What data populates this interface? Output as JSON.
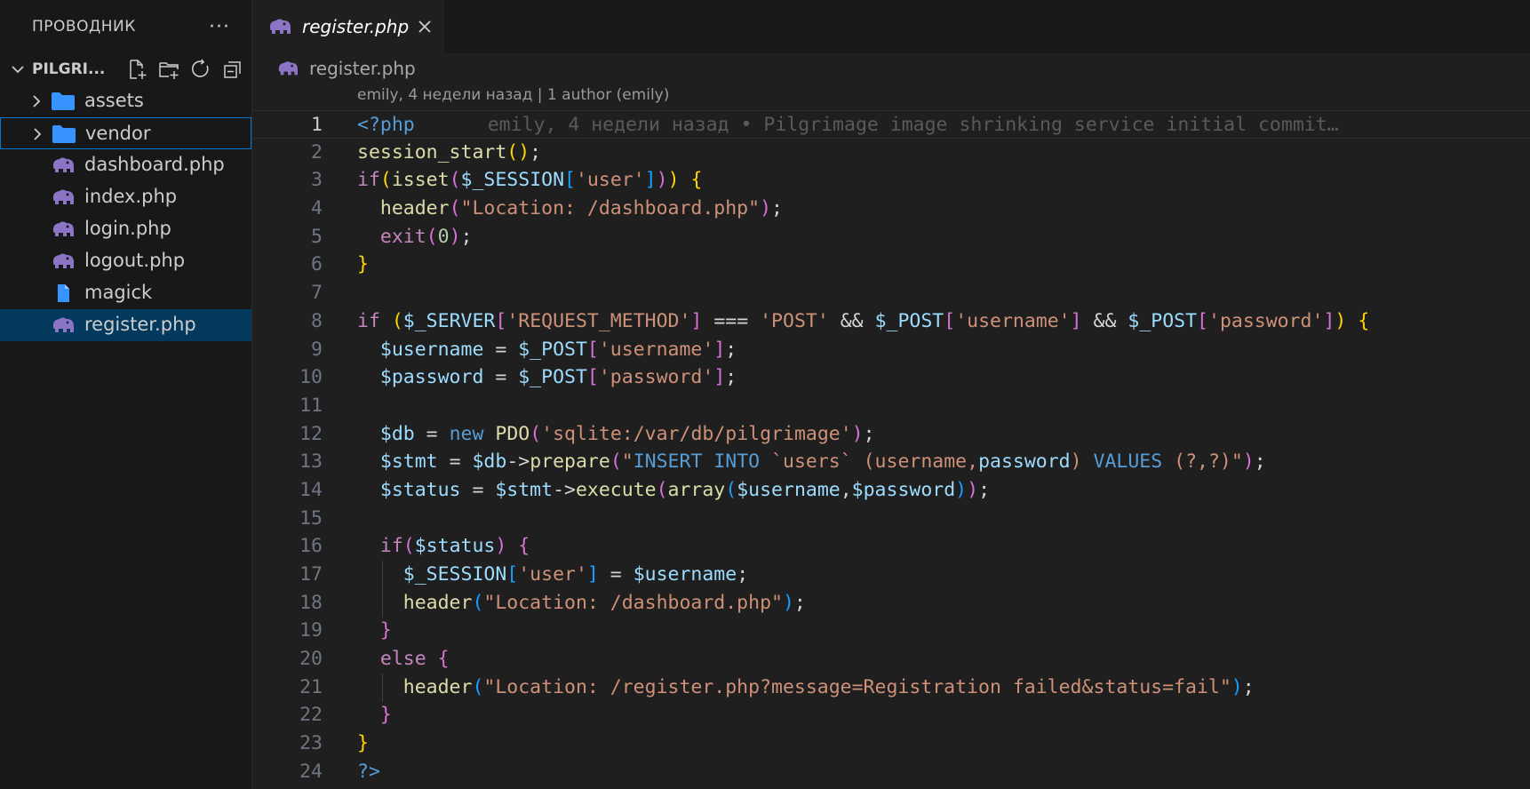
{
  "explorer": {
    "title": "ПРОВОДНИК",
    "more": "···",
    "folder": "PILGRI...",
    "items": [
      {
        "label": "assets",
        "type": "folder"
      },
      {
        "label": "vendor",
        "type": "folder"
      },
      {
        "label": "dashboard.php",
        "type": "php"
      },
      {
        "label": "index.php",
        "type": "php"
      },
      {
        "label": "login.php",
        "type": "php"
      },
      {
        "label": "logout.php",
        "type": "php"
      },
      {
        "label": "magick",
        "type": "file"
      },
      {
        "label": "register.php",
        "type": "php"
      }
    ]
  },
  "tab": {
    "label": "register.php",
    "close": "close-icon"
  },
  "breadcrumb": {
    "label": "register.php"
  },
  "codelens": "emily, 4 недели назад | 1 author (emily)",
  "blame": "emily, 4 недели назад • Pilgrimage image shrinking service initial commit…",
  "colors": {
    "accent": "#0078d4",
    "selected": "#04395e",
    "php_icon": "#8c75c4",
    "folder": "#3794ff"
  },
  "code": {
    "lines": [
      [
        [
          "tag",
          "<?php"
        ]
      ],
      [
        [
          "fn",
          "session_start"
        ],
        [
          "b1",
          "()"
        ],
        [
          "txt",
          ";"
        ]
      ],
      [
        [
          "ctl",
          "if"
        ],
        [
          "b1",
          "("
        ],
        [
          "fn",
          "isset"
        ],
        [
          "b2",
          "("
        ],
        [
          "var",
          "$_SESSION"
        ],
        [
          "b3",
          "["
        ],
        [
          "str",
          "'user'"
        ],
        [
          "b3",
          "]"
        ],
        [
          "b2",
          ")"
        ],
        [
          "b1",
          ")"
        ],
        [
          "txt",
          " "
        ],
        [
          "b1",
          "{"
        ]
      ],
      [
        [
          "txt",
          "  "
        ],
        [
          "fn",
          "header"
        ],
        [
          "b2",
          "("
        ],
        [
          "str",
          "\"Location: /dashboard.php\""
        ],
        [
          "b2",
          ")"
        ],
        [
          "txt",
          ";"
        ]
      ],
      [
        [
          "txt",
          "  "
        ],
        [
          "ctl",
          "exit"
        ],
        [
          "b2",
          "("
        ],
        [
          "num",
          "0"
        ],
        [
          "b2",
          ")"
        ],
        [
          "txt",
          ";"
        ]
      ],
      [
        [
          "b1",
          "}"
        ]
      ],
      [],
      [
        [
          "ctl",
          "if"
        ],
        [
          "txt",
          " "
        ],
        [
          "b1",
          "("
        ],
        [
          "var",
          "$_SERVER"
        ],
        [
          "b2",
          "["
        ],
        [
          "str",
          "'REQUEST_METHOD'"
        ],
        [
          "b2",
          "]"
        ],
        [
          "txt",
          " === "
        ],
        [
          "str",
          "'POST'"
        ],
        [
          "txt",
          " && "
        ],
        [
          "var",
          "$_POST"
        ],
        [
          "b2",
          "["
        ],
        [
          "str",
          "'username'"
        ],
        [
          "b2",
          "]"
        ],
        [
          "txt",
          " && "
        ],
        [
          "var",
          "$_POST"
        ],
        [
          "b2",
          "["
        ],
        [
          "str",
          "'password'"
        ],
        [
          "b2",
          "]"
        ],
        [
          "b1",
          ")"
        ],
        [
          "txt",
          " "
        ],
        [
          "b1",
          "{"
        ]
      ],
      [
        [
          "txt",
          "  "
        ],
        [
          "var",
          "$username"
        ],
        [
          "txt",
          " = "
        ],
        [
          "var",
          "$_POST"
        ],
        [
          "b2",
          "["
        ],
        [
          "str",
          "'username'"
        ],
        [
          "b2",
          "]"
        ],
        [
          "txt",
          ";"
        ]
      ],
      [
        [
          "txt",
          "  "
        ],
        [
          "var",
          "$password"
        ],
        [
          "txt",
          " = "
        ],
        [
          "var",
          "$_POST"
        ],
        [
          "b2",
          "["
        ],
        [
          "str",
          "'password'"
        ],
        [
          "b2",
          "]"
        ],
        [
          "txt",
          ";"
        ]
      ],
      [],
      [
        [
          "txt",
          "  "
        ],
        [
          "var",
          "$db"
        ],
        [
          "txt",
          " = "
        ],
        [
          "kw",
          "new"
        ],
        [
          "txt",
          " "
        ],
        [
          "fn",
          "PDO"
        ],
        [
          "b2",
          "("
        ],
        [
          "str",
          "'sqlite:/var/db/pilgrimage'"
        ],
        [
          "b2",
          ")"
        ],
        [
          "txt",
          ";"
        ]
      ],
      [
        [
          "txt",
          "  "
        ],
        [
          "var",
          "$stmt"
        ],
        [
          "txt",
          " = "
        ],
        [
          "var",
          "$db"
        ],
        [
          "txt",
          "->"
        ],
        [
          "fn",
          "prepare"
        ],
        [
          "b2",
          "("
        ],
        [
          "str",
          "\""
        ],
        [
          "kw",
          "INSERT INTO"
        ],
        [
          "str",
          " `users` (username,"
        ],
        [
          "var",
          "password"
        ],
        [
          "str",
          ") "
        ],
        [
          "kw",
          "VALUES"
        ],
        [
          "str",
          " (?,?)\""
        ],
        [
          "b2",
          ")"
        ],
        [
          "txt",
          ";"
        ]
      ],
      [
        [
          "txt",
          "  "
        ],
        [
          "var",
          "$status"
        ],
        [
          "txt",
          " = "
        ],
        [
          "var",
          "$stmt"
        ],
        [
          "txt",
          "->"
        ],
        [
          "fn",
          "execute"
        ],
        [
          "b2",
          "("
        ],
        [
          "fn",
          "array"
        ],
        [
          "b3",
          "("
        ],
        [
          "var",
          "$username"
        ],
        [
          "txt",
          ","
        ],
        [
          "var",
          "$password"
        ],
        [
          "b3",
          ")"
        ],
        [
          "b2",
          ")"
        ],
        [
          "txt",
          ";"
        ]
      ],
      [],
      [
        [
          "txt",
          "  "
        ],
        [
          "ctl",
          "if"
        ],
        [
          "b2",
          "("
        ],
        [
          "var",
          "$status"
        ],
        [
          "b2",
          ")"
        ],
        [
          "txt",
          " "
        ],
        [
          "b2",
          "{"
        ]
      ],
      [
        [
          "txt",
          "    "
        ],
        [
          "var",
          "$_SESSION"
        ],
        [
          "b3",
          "["
        ],
        [
          "str",
          "'user'"
        ],
        [
          "b3",
          "]"
        ],
        [
          "txt",
          " = "
        ],
        [
          "var",
          "$username"
        ],
        [
          "txt",
          ";"
        ]
      ],
      [
        [
          "txt",
          "    "
        ],
        [
          "fn",
          "header"
        ],
        [
          "b3",
          "("
        ],
        [
          "str",
          "\"Location: /dashboard.php\""
        ],
        [
          "b3",
          ")"
        ],
        [
          "txt",
          ";"
        ]
      ],
      [
        [
          "txt",
          "  "
        ],
        [
          "b2",
          "}"
        ]
      ],
      [
        [
          "txt",
          "  "
        ],
        [
          "ctl",
          "else"
        ],
        [
          "txt",
          " "
        ],
        [
          "b2",
          "{"
        ]
      ],
      [
        [
          "txt",
          "    "
        ],
        [
          "fn",
          "header"
        ],
        [
          "b3",
          "("
        ],
        [
          "str",
          "\"Location: /register.php?message=Registration failed&status=fail\""
        ],
        [
          "b3",
          ")"
        ],
        [
          "txt",
          ";"
        ]
      ],
      [
        [
          "txt",
          "  "
        ],
        [
          "b2",
          "}"
        ]
      ],
      [
        [
          "b1",
          "}"
        ]
      ],
      [
        [
          "tag",
          "?>"
        ]
      ]
    ]
  }
}
